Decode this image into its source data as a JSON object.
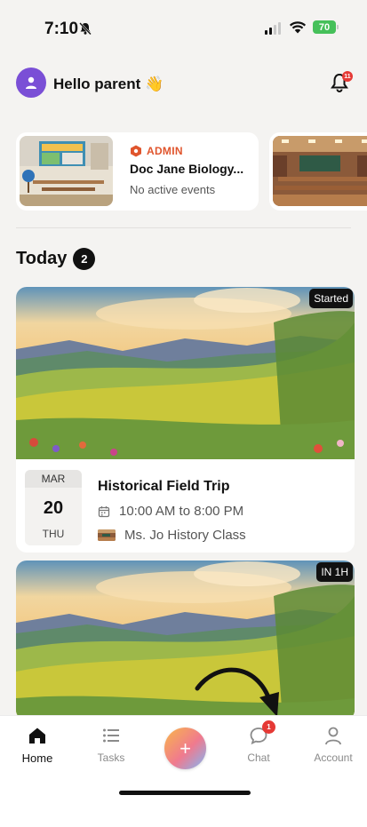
{
  "status_bar": {
    "time": "7:10",
    "battery": "70"
  },
  "header": {
    "greeting": "Hello parent",
    "greeting_emoji": "👋",
    "notification_count": "11"
  },
  "classes": [
    {
      "role": "ADMIN",
      "name": "Doc Jane Biology...",
      "events": "No active events"
    }
  ],
  "today": {
    "title": "Today",
    "count": "2"
  },
  "events": [
    {
      "status": "Started",
      "month": "MAR",
      "day": "20",
      "weekday": "THU",
      "title": "Historical Field Trip",
      "time": "10:00 AM to 8:00 PM",
      "class_name": "Ms. Jo History Class"
    },
    {
      "status": "IN 1H"
    }
  ],
  "tabs": {
    "home": "Home",
    "tasks": "Tasks",
    "add": "+",
    "chat": "Chat",
    "chat_badge": "1",
    "account": "Account"
  },
  "icons": {
    "bell_off": "bell-slash-icon",
    "signal": "cellular-signal-icon",
    "wifi": "wifi-icon",
    "battery": "battery-charging-icon",
    "notification": "bell-icon",
    "admin": "shield-icon",
    "calendar": "calendar-icon",
    "home": "home-icon",
    "tasks": "list-icon",
    "chat": "chat-bubble-icon",
    "account": "person-icon"
  },
  "colors": {
    "admin": "#e0552d",
    "avatar": "#7a4fd6",
    "badge": "#e53935",
    "battery": "#46c05a"
  }
}
